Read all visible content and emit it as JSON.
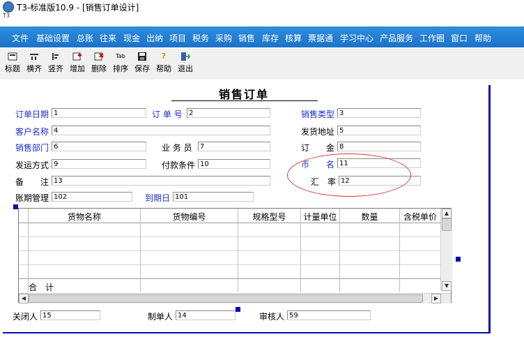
{
  "window": {
    "title": "T3-标准版10.9 - [销售订单设计]",
    "small_tag": "T3"
  },
  "menu": [
    "文件",
    "基础设置",
    "总账",
    "往来",
    "现金",
    "出纳",
    "项目",
    "税务",
    "采购",
    "销售",
    "库存",
    "核算",
    "票据通",
    "学习中心",
    "产品服务",
    "工作圈",
    "窗口",
    "帮助"
  ],
  "toolbar": [
    {
      "label": "标题",
      "icon": "title-icon"
    },
    {
      "label": "横齐",
      "icon": "align-horizontal-icon"
    },
    {
      "label": "竖齐",
      "icon": "align-vertical-icon"
    },
    {
      "label": "增加",
      "icon": "add-icon"
    },
    {
      "label": "删除",
      "icon": "delete-icon"
    },
    {
      "label": "排序",
      "icon": "tab-order-icon"
    },
    {
      "label": "保存",
      "icon": "save-icon"
    },
    {
      "label": "帮助",
      "icon": "help-icon"
    },
    {
      "label": "退出",
      "icon": "exit-icon"
    }
  ],
  "toolbar_tab_glyph": "Tab",
  "form": {
    "title": "销售订单",
    "fields": {
      "order_date": {
        "label": "订单日期",
        "value": "1"
      },
      "order_no": {
        "label": "订 单 号",
        "value": "2"
      },
      "sales_type": {
        "label": "销售类型",
        "value": "3"
      },
      "customer": {
        "label": "客户名称",
        "value": "4"
      },
      "ship_address": {
        "label": "发货地址",
        "value": "5"
      },
      "sales_dept": {
        "label": "销售部门",
        "value": "6"
      },
      "salesperson": {
        "label": "业 务 员",
        "value": "7"
      },
      "deposit": {
        "label": "订　　金",
        "value": "8"
      },
      "ship_method": {
        "label": "发运方式",
        "value": "9"
      },
      "payment_terms": {
        "label": "付款条件",
        "value": "10"
      },
      "currency": {
        "label": "币　　名",
        "value": "11"
      },
      "remark": {
        "label": "备　　注",
        "value": "13"
      },
      "exchange_rate": {
        "label": "汇　率",
        "value": "12"
      },
      "account_mgmt": {
        "label": "账期管理",
        "value": "102"
      },
      "due_date": {
        "label": "到期日",
        "value": "101"
      }
    },
    "grid": {
      "columns": [
        "货物名称",
        "货物编号",
        "规格型号",
        "计量单位",
        "数量",
        "含税单价"
      ],
      "total_label": "合　计"
    },
    "footer": {
      "closer": {
        "label": "关闭人",
        "value": "15"
      },
      "maker": {
        "label": "制单人",
        "value": "14"
      },
      "auditor": {
        "label": "审核人",
        "value": "59"
      }
    }
  },
  "colors": {
    "menu_bar": "#1b72c8",
    "label_blue": "#1c2fd0",
    "design_border": "#0b0bb0",
    "annotation_circle": "#d23b3b"
  }
}
